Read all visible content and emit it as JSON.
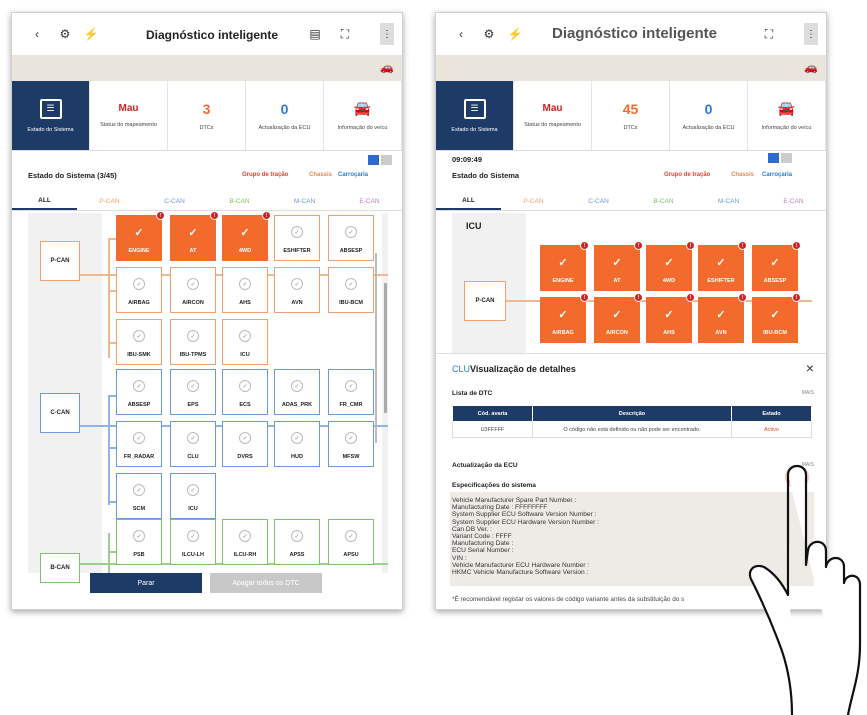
{
  "screen1": {
    "back_icon": "chevron-left-icon",
    "title": "Diagnóstico inteligente",
    "cards": [
      {
        "value": "",
        "label": "Estado do Sistema"
      },
      {
        "value": "Mau",
        "label": "Status do mapeamento"
      },
      {
        "value": "3",
        "label": "DTCs"
      },
      {
        "value": "0",
        "label": "Actualização da ECU"
      },
      {
        "value": "",
        "label": "Informação do veícu"
      }
    ],
    "status_title": "Estado do Sistema (3/45)",
    "groups": [
      "Grupo de tração",
      "Chassis",
      "Carroçaria"
    ],
    "tabs": [
      "ALL",
      "P-CAN",
      "C-CAN",
      "B-CAN",
      "M-CAN",
      "E-CAN"
    ],
    "buses": [
      "P-CAN",
      "C-CAN",
      "B-CAN"
    ],
    "pcan_nodes": [
      "ENGINE",
      "AT",
      "4WD",
      "ESHIFTER",
      "ABSESP",
      "AIRBAG",
      "AIRCON",
      "AHS",
      "AVN",
      "IBU-BCM",
      "IBU-SMK",
      "IBU-TPMS",
      "ICU"
    ],
    "ccan_nodes": [
      "ABSESP",
      "EPS",
      "ECS",
      "ADAS_PRK",
      "FR_CMR",
      "FR_RADAR",
      "CLU",
      "DVRS",
      "HUD",
      "MFSW",
      "SCM",
      "ICU"
    ],
    "bcan_nodes": [
      "PSB",
      "ILCU-LH",
      "ILCU-RH",
      "APSS",
      "APSU"
    ],
    "stop_button": "Parar",
    "clear_button": "Apagar todos os DTC"
  },
  "screen2": {
    "title": "Diagnóstico inteligente",
    "cards": [
      {
        "value": "",
        "label": "Estado do Sistema"
      },
      {
        "value": "Mau",
        "label": "Status do mapeamento"
      },
      {
        "value": "45",
        "label": "DTCs"
      },
      {
        "value": "0",
        "label": "Actualização da ECU"
      },
      {
        "value": "",
        "label": "Informação do veícu"
      }
    ],
    "time": "09:09:49",
    "status_title": "Estado do Sistema",
    "groups": [
      "Grupo de tração",
      "Chassis",
      "Carroçaria"
    ],
    "tabs": [
      "ALL",
      "P-CAN",
      "C-CAN",
      "B-CAN",
      "M-CAN",
      "E-CAN"
    ],
    "section": "ICU",
    "bus": "P-CAN",
    "row1": [
      "ENGINE",
      "AT",
      "4WD",
      "ESHIFTER",
      "ABSESP"
    ],
    "row2": [
      "AIRBAG",
      "AIRCON",
      "AHS",
      "AVN",
      "IBU-BCM"
    ],
    "detail_prefix": "CLU",
    "detail_title": "Visualização de detalhes",
    "dtc_list_label": "Lista de DTC",
    "more_label": "MAIS",
    "table_headers": [
      "Cód. avaria",
      "Descrição",
      "Estado"
    ],
    "table_row": [
      "U3FFFFF",
      "O código não está definido ou não pode ser encontrado.",
      "Activo"
    ],
    "ecu_update_label": "Actualização da ECU",
    "spec_label": "Especificações do sistema",
    "spec_lines": [
      "Vehicle Manufacturer Spare Part Number :",
      "Manufacturing Date : FFFFFFFF",
      "System Supplier ECU Software Version Number :",
      "System Supplier ECU Hardware Version Number :",
      "Can DB Ver. :",
      "Variant Code : FFFF",
      "Manufacturing Date :",
      "ECU Serial Number :",
      "VIN :",
      "Vehicle Manufacturer ECU Hardware Number :",
      "HKMC Vehicle Manufacture Software Version :"
    ],
    "footnote": "*É recomendável registar os valores de código variante antes da substituição do s"
  },
  "colors": {
    "navy": "#1e3a66",
    "error": "#f26b2c",
    "badge": "#d42020",
    "p_can": "#f0a070",
    "c_can": "#6a9ad8",
    "b_can": "#7cc36a",
    "tap": "#e8202a"
  }
}
